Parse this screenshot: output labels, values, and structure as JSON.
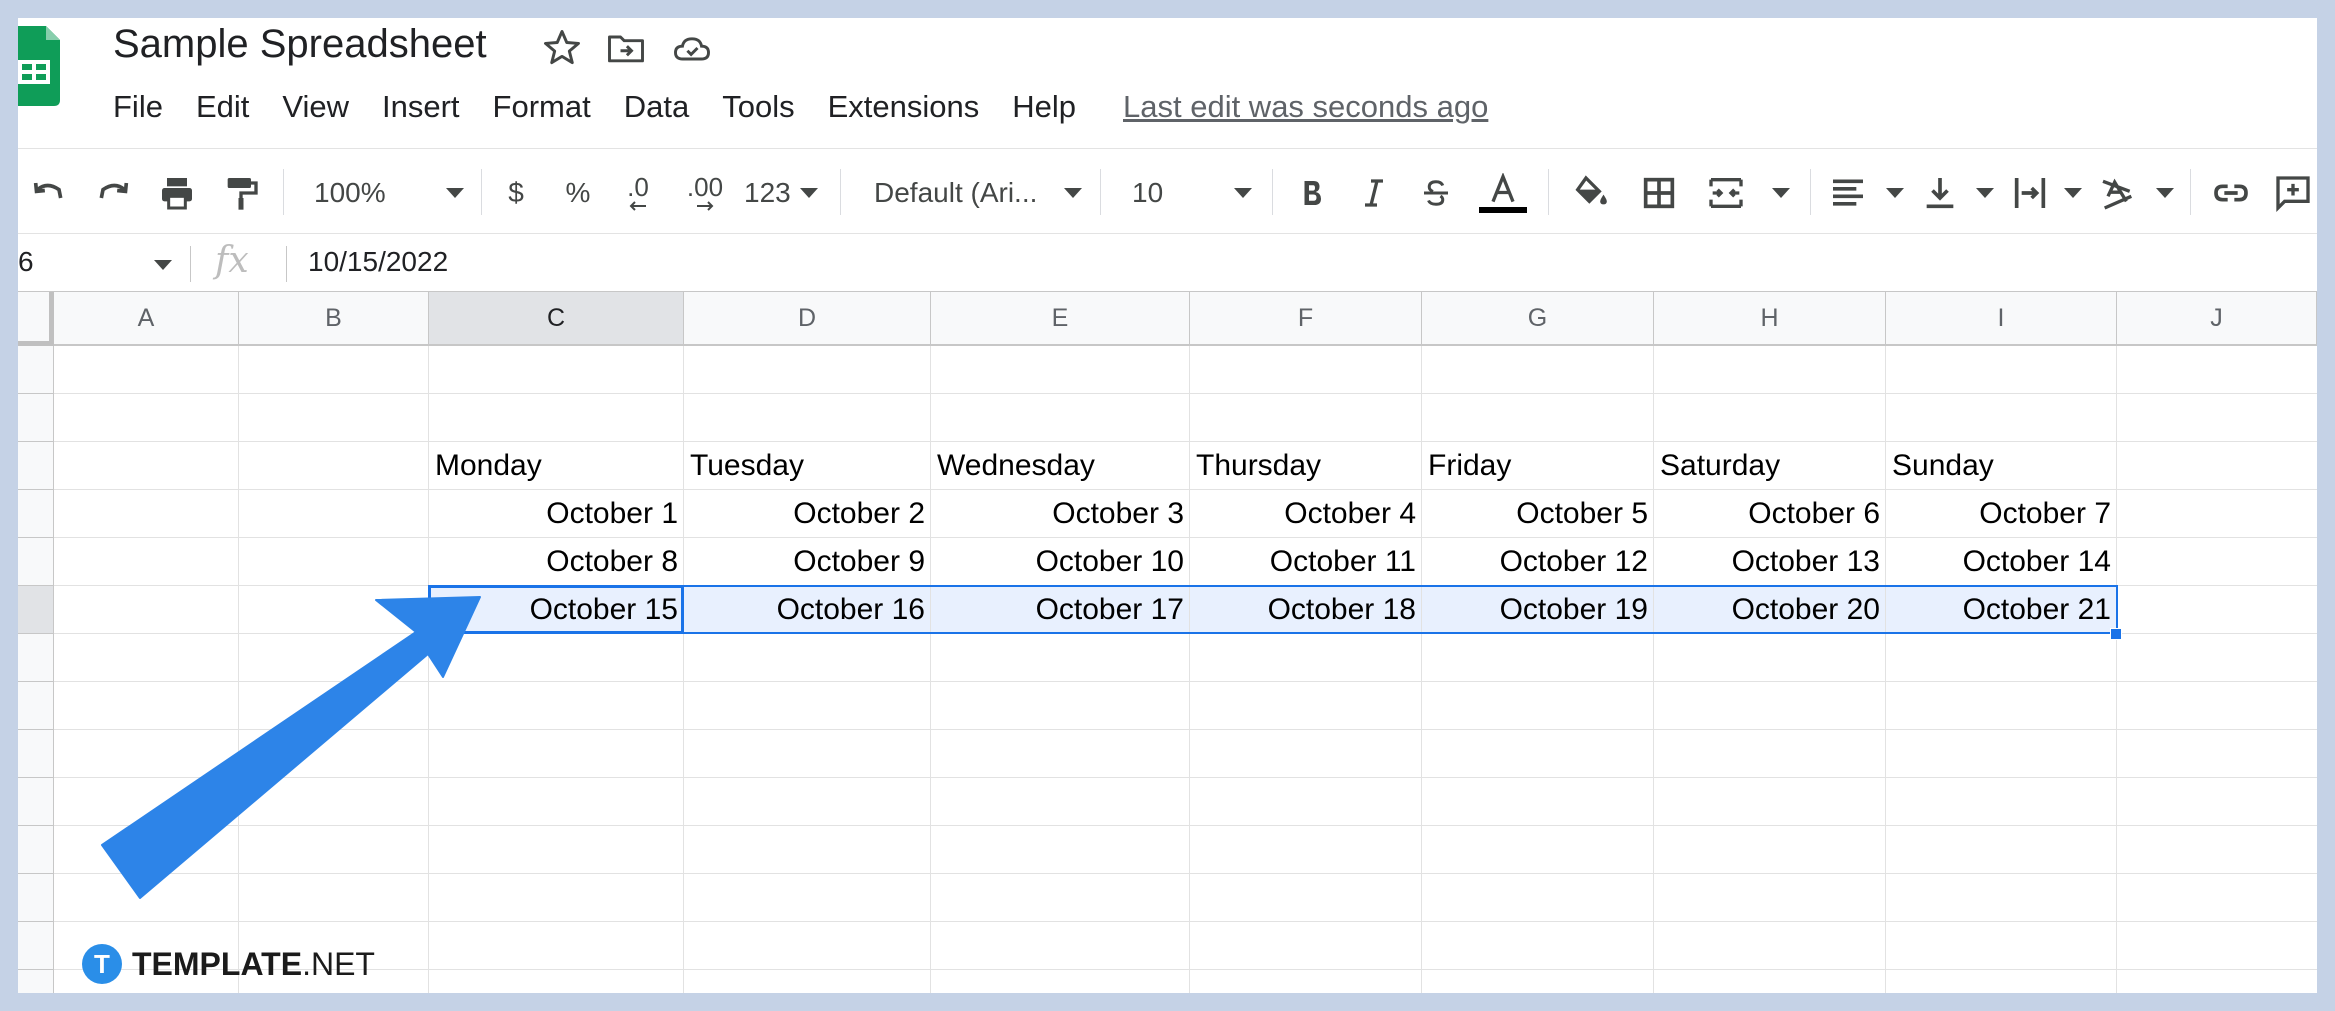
{
  "app": {
    "title": "Sample Spreadsheet",
    "last_edit": "Last edit was seconds ago"
  },
  "menu": [
    "File",
    "Edit",
    "View",
    "Insert",
    "Format",
    "Data",
    "Tools",
    "Extensions",
    "Help"
  ],
  "toolbar": {
    "zoom": "100%",
    "currency": "$",
    "percent": "%",
    "decrease_decimal": ".0",
    "increase_decimal": ".00",
    "more_formats": "123",
    "font": "Default (Ari...",
    "font_size": "10",
    "icons": [
      "undo-icon",
      "redo-icon",
      "print-icon",
      "paint-format-icon",
      "bold-icon",
      "italic-icon",
      "strikethrough-icon",
      "text-color-icon",
      "fill-color-icon",
      "borders-icon",
      "merge-cells-icon",
      "horizontal-align-icon",
      "vertical-align-icon",
      "text-wrapping-icon",
      "text-rotation-icon",
      "link-icon",
      "comment-icon"
    ]
  },
  "formula_bar": {
    "name_box": "6",
    "fx_label": "fx",
    "value": "10/15/2022"
  },
  "columns": [
    "A",
    "B",
    "C",
    "D",
    "E",
    "F",
    "G",
    "H",
    "I",
    "J"
  ],
  "active_column": "C",
  "sheet": {
    "header_row": [
      "Monday",
      "Tuesday",
      "Wednesday",
      "Thursday",
      "Friday",
      "Saturday",
      "Sunday"
    ],
    "week_rows": [
      [
        "October 1",
        "October 2",
        "October 3",
        "October 4",
        "October 5",
        "October 6",
        "October 7"
      ],
      [
        "October 8",
        "October 9",
        "October 10",
        "October 11",
        "October 12",
        "October 13",
        "October 14"
      ],
      [
        "October 15",
        "October 16",
        "October 17",
        "October 18",
        "October 19",
        "October 20",
        "October 21"
      ]
    ],
    "selected_row_index": 2
  },
  "colors": {
    "selection": "#1a73e8",
    "selection_fill": "#e8f0fe",
    "arrow": "#2d84e8",
    "sheets_green": "#0f9d58"
  },
  "watermark": {
    "logo_letter": "T",
    "brand_bold": "TEMPLATE",
    "brand_rest": ".NET"
  }
}
